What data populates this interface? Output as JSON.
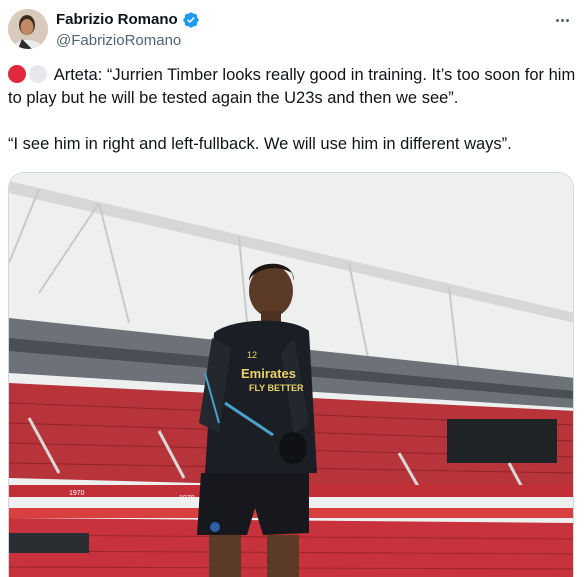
{
  "author": {
    "display_name": "Fabrizio Romano",
    "handle": "@FabrizioRomano",
    "verified": true
  },
  "tweet": {
    "paragraph_1": "Arteta: “Jurrien Timber looks really good in training. It’s too soon for him to play but he will be tested again the U23s and then we see”.",
    "paragraph_2": "“I see him in right and left-fullback. We will use him in different ways”.",
    "emoji": [
      "red-circle",
      "white-circle"
    ]
  },
  "media": {
    "shirt_sponsor": "Emirates",
    "shirt_sponsor_line2": "FLY BETTER",
    "shirt_number": "12",
    "stand_numbers": [
      "1970",
      "1970"
    ]
  },
  "colors": {
    "verified": "#1d9bf0",
    "text": "#0f1419",
    "secondary": "#536471",
    "seats": "#c8323c"
  }
}
